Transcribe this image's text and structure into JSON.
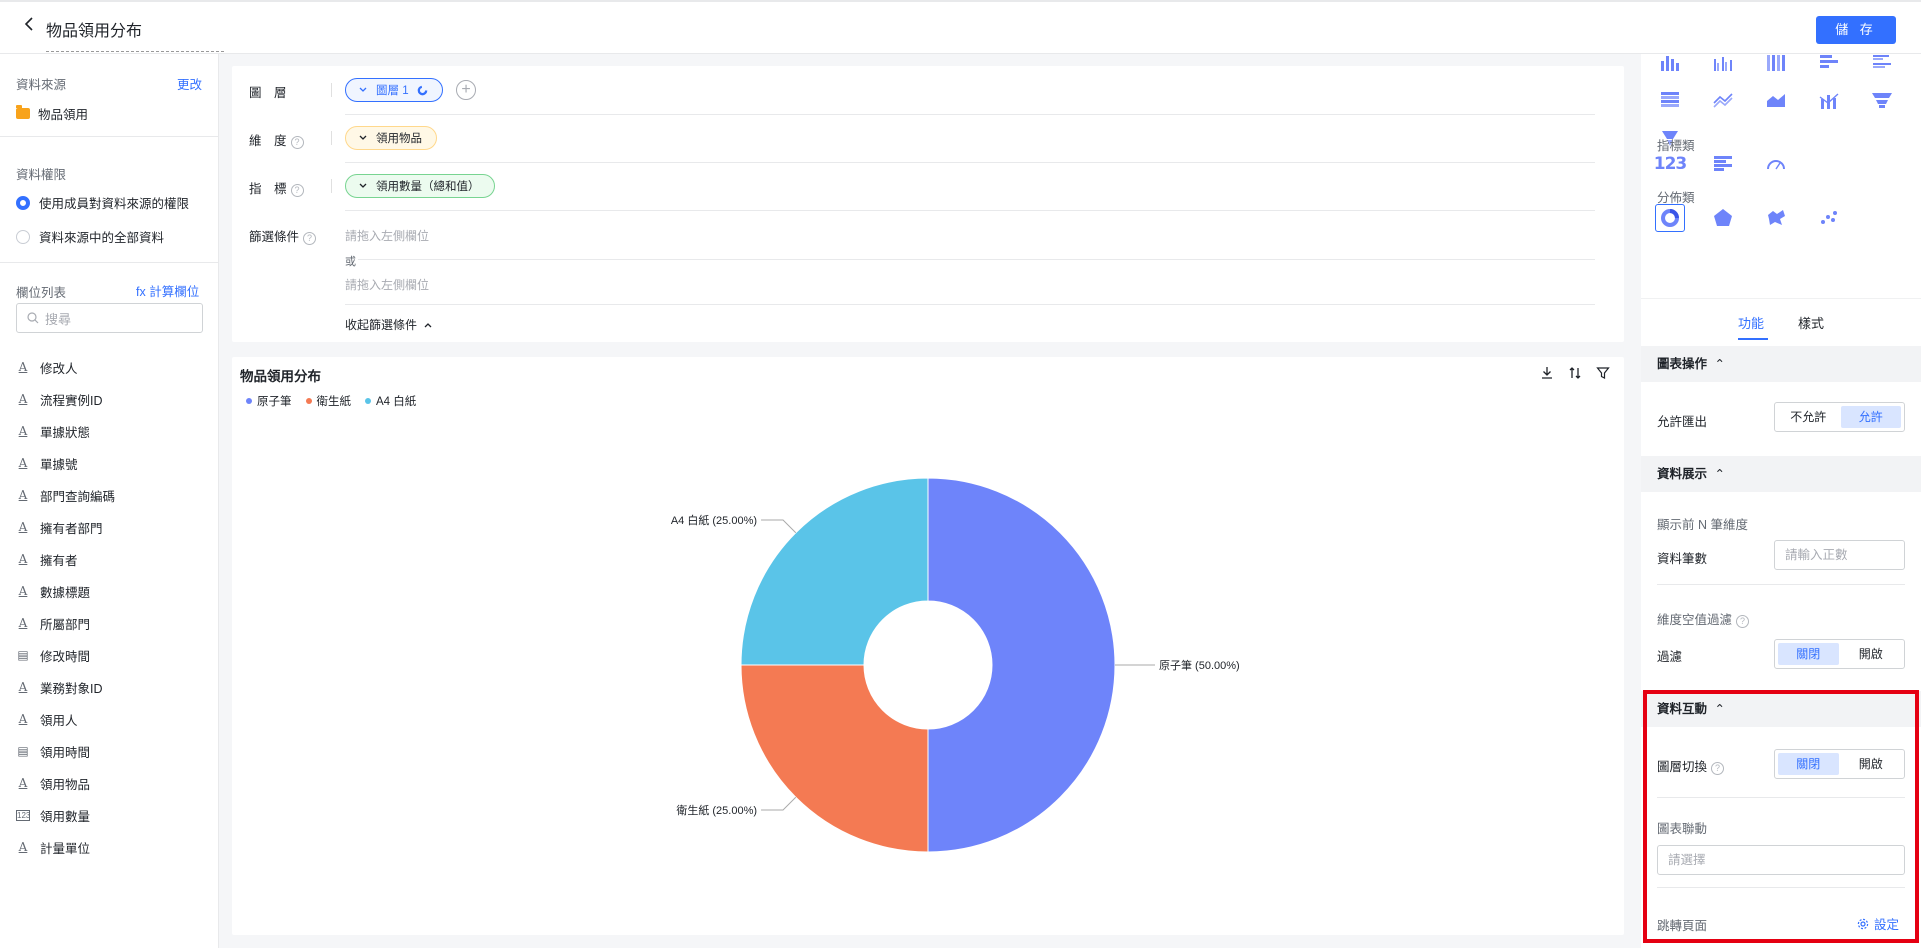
{
  "header": {
    "title": "物品領用分布",
    "save_label": "儲 存"
  },
  "left": {
    "datasource_label": "資料來源",
    "change_label": "更改",
    "datasource_name": "物品領用",
    "permission_label": "資料權限",
    "permission_options": [
      "使用成員對資料來源的權限",
      "資料來源中的全部資料"
    ],
    "field_list_label": "欄位列表",
    "calc_field_label": "fx 計算欄位",
    "search_placeholder": "搜尋",
    "fields": [
      {
        "name": "修改人",
        "type": "text"
      },
      {
        "name": "流程實例ID",
        "type": "text"
      },
      {
        "name": "單據狀態",
        "type": "text"
      },
      {
        "name": "單據號",
        "type": "text"
      },
      {
        "name": "部門查詢編碼",
        "type": "text"
      },
      {
        "name": "擁有者部門",
        "type": "text"
      },
      {
        "name": "擁有者",
        "type": "text"
      },
      {
        "name": "數據標題",
        "type": "text"
      },
      {
        "name": "所屬部門",
        "type": "text"
      },
      {
        "name": "修改時間",
        "type": "date"
      },
      {
        "name": "業務對象ID",
        "type": "text"
      },
      {
        "name": "領用人",
        "type": "text"
      },
      {
        "name": "領用時間",
        "type": "date"
      },
      {
        "name": "領用物品",
        "type": "text"
      },
      {
        "name": "領用數量",
        "type": "number"
      },
      {
        "name": "計量單位",
        "type": "text"
      }
    ]
  },
  "config": {
    "layer_label": "圖　層",
    "layer_value": "圖層 1",
    "dimension_label": "維　度",
    "dimension_value": "領用物品",
    "measure_label": "指　標",
    "measure_value": "領用數量（總和值）",
    "filter_label": "篩選條件",
    "filter_placeholder_1": "請拖入左側欄位",
    "filter_or": "或",
    "filter_placeholder_2": "請拖入左側欄位",
    "collapse_label": "收起篩選條件"
  },
  "chart": {
    "title": "物品領用分布",
    "tools": [
      "download-icon",
      "sort-icon",
      "filter-icon"
    ]
  },
  "chart_data": {
    "type": "pie",
    "donut": true,
    "title": "物品領用分布",
    "legend_position": "top-left",
    "categories": [
      "原子筆",
      "衛生紙",
      "A4 白紙"
    ],
    "values": [
      50.0,
      25.0,
      25.0
    ],
    "labels": [
      "原子筆 (50.00%)",
      "衛生紙 (25.00%)",
      "A4 白紙 (25.00%)"
    ],
    "colors": [
      "#6e84fa",
      "#f47a53",
      "#5ac4e8"
    ]
  },
  "right": {
    "indicator_group": "指標類",
    "distribution_group": "分佈類",
    "tabs": [
      "功能",
      "樣式"
    ],
    "chart_ops_header": "圖表操作",
    "allow_export_label": "允許匯出",
    "export_options": [
      "不允許",
      "允許"
    ],
    "data_display_header": "資料展示",
    "top_n_label": "顯示前 N 筆維度",
    "record_count_label": "資料筆數",
    "record_count_placeholder": "請輸入正數",
    "null_filter_label": "維度空值過濾",
    "filter_label": "過濾",
    "toggle_options": [
      "關閉",
      "開啟"
    ],
    "interaction_header": "資料互動",
    "layer_switch_label": "圖層切換",
    "chart_link_label": "圖表聯動",
    "chart_link_placeholder": "請選擇",
    "jump_page_label": "跳轉頁面",
    "settings_label": "設定"
  },
  "colors": {
    "accent": "#3370ff",
    "highlight": "#e50012"
  }
}
